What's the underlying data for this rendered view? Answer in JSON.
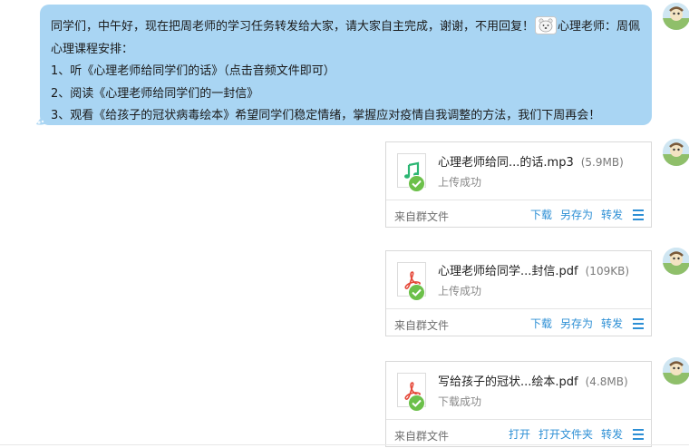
{
  "message": {
    "lines": [
      "同学们，中午好，现在把周老师的学习任务转发给大家，请大家自主完成，谢谢，不用回复！",
      "心理老师：周佩",
      "心理课程安排：",
      "1、听《心理老师给同学们的话》（点击音频文件即可）",
      "2、阅读《心理老师给同学们的一封信》",
      "3、观看《给孩子的冠状病毒绘本》希望同学们稳定情绪，掌握应对疫情自我调整的方法，我们下周再会！"
    ],
    "emoji_icon": "bear-emoji-icon"
  },
  "files": [
    {
      "name": "心理老师给同...的话.mp3",
      "size": "(5.9MB)",
      "status": "上传成功",
      "source": "来自群文件",
      "icon": "music-note-icon",
      "actions": [
        "下载",
        "另存为",
        "转发"
      ]
    },
    {
      "name": "心理老师给同学...封信.pdf",
      "size": "(109KB)",
      "status": "上传成功",
      "source": "来自群文件",
      "icon": "pdf-icon",
      "actions": [
        "下载",
        "另存为",
        "转发"
      ]
    },
    {
      "name": "写给孩子的冠状...绘本.pdf",
      "size": "(4.8MB)",
      "status": "下载成功",
      "source": "来自群文件",
      "icon": "pdf-icon",
      "actions": [
        "打开",
        "打开文件夹",
        "转发"
      ]
    }
  ],
  "colors": {
    "bubble": "#a9d5f3",
    "link": "#2d8fd5",
    "success": "#6cc04a",
    "pdf": "#e5493a",
    "music": "#2bb673"
  }
}
